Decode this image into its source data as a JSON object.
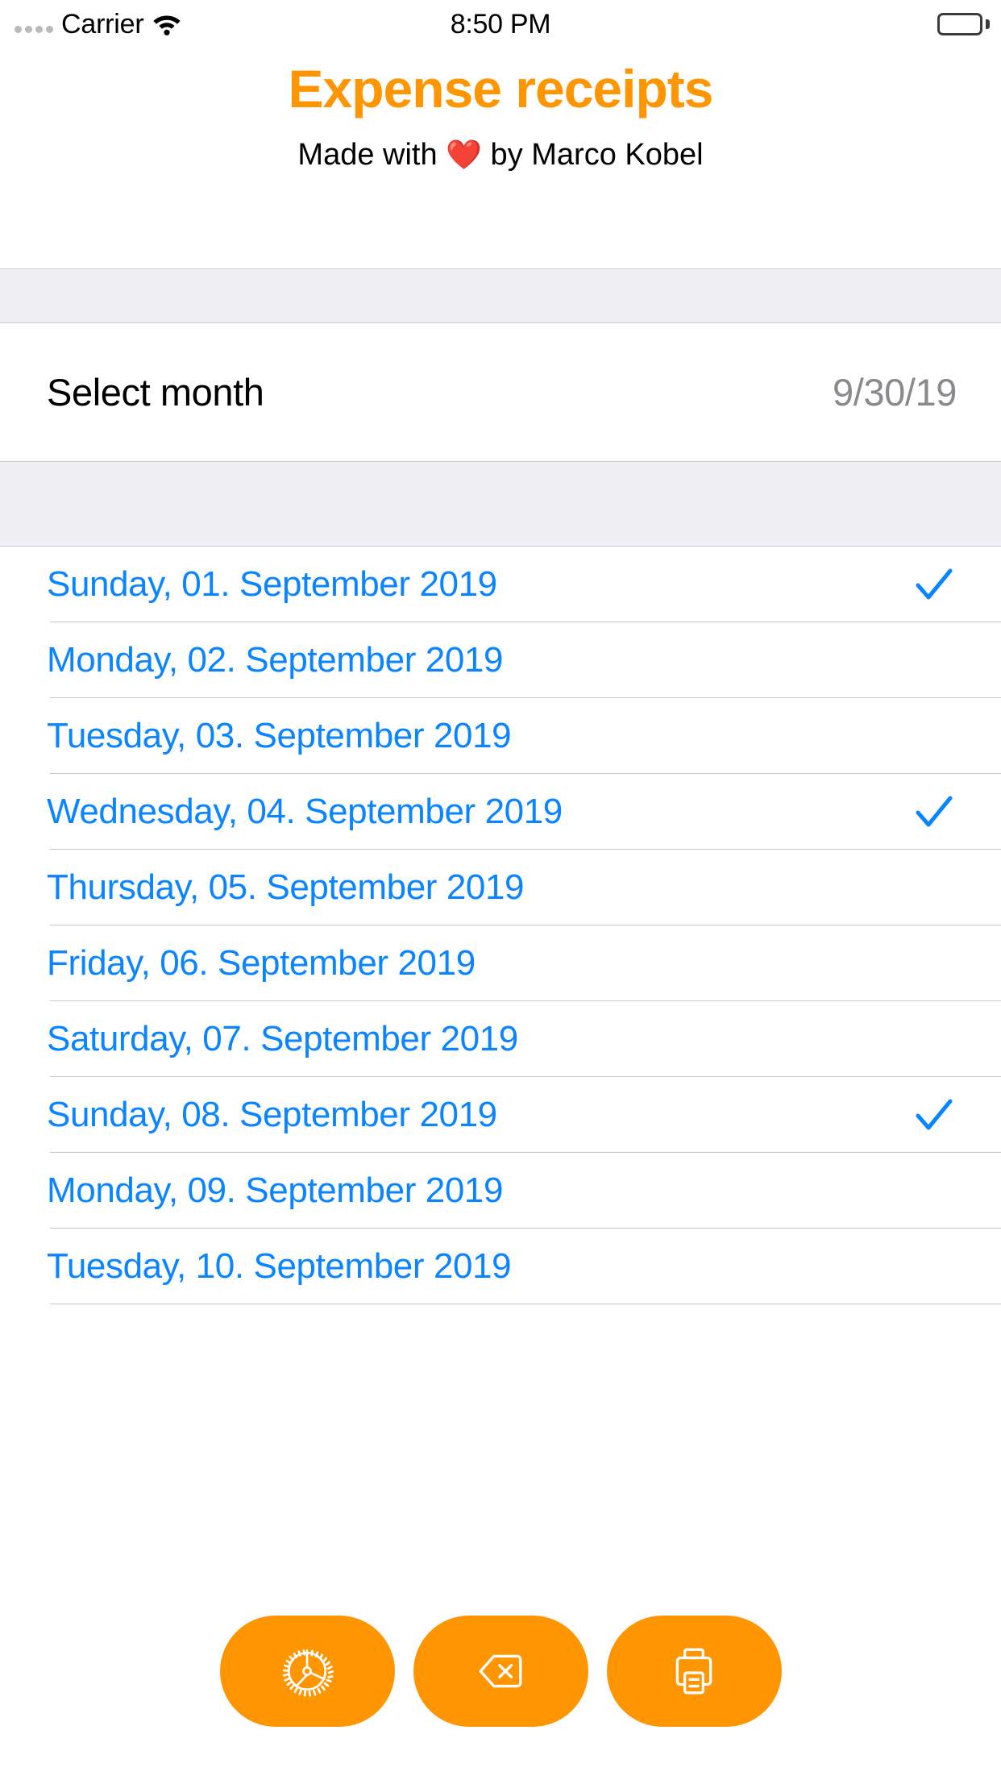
{
  "status_bar": {
    "carrier": "Carrier",
    "time": "8:50 PM",
    "wifi_icon": "wifi-icon",
    "battery_icon": "battery-full-icon",
    "signal_icon": "signal-dots-icon"
  },
  "header": {
    "title": "Expense receipts",
    "subtitle_prefix": "Made with ",
    "subtitle_heart": "❤️",
    "subtitle_suffix": " by Marco Kobel",
    "title_color": "#FF9500"
  },
  "select_month_row": {
    "label": "Select month",
    "value": "9/30/19"
  },
  "colors": {
    "accent_orange": "#FF9500",
    "link_blue": "#0A84FF",
    "group_grey": "#F0F0F4",
    "value_grey": "#8A8A8E",
    "separator": "#C8C7CC"
  },
  "days": [
    {
      "label": "Sunday, 01. September 2019",
      "checked": true
    },
    {
      "label": "Monday, 02. September 2019",
      "checked": false
    },
    {
      "label": "Tuesday, 03. September 2019",
      "checked": false
    },
    {
      "label": "Wednesday, 04. September 2019",
      "checked": true
    },
    {
      "label": "Thursday, 05. September 2019",
      "checked": false
    },
    {
      "label": "Friday, 06. September 2019",
      "checked": false
    },
    {
      "label": "Saturday, 07. September 2019",
      "checked": false
    },
    {
      "label": "Sunday, 08. September 2019",
      "checked": true
    },
    {
      "label": "Monday, 09. September 2019",
      "checked": false
    },
    {
      "label": "Tuesday, 10. September 2019",
      "checked": false
    }
  ],
  "toolbar": {
    "settings_icon": "gear-icon",
    "delete_icon": "delete-backspace-icon",
    "print_icon": "printer-icon"
  }
}
